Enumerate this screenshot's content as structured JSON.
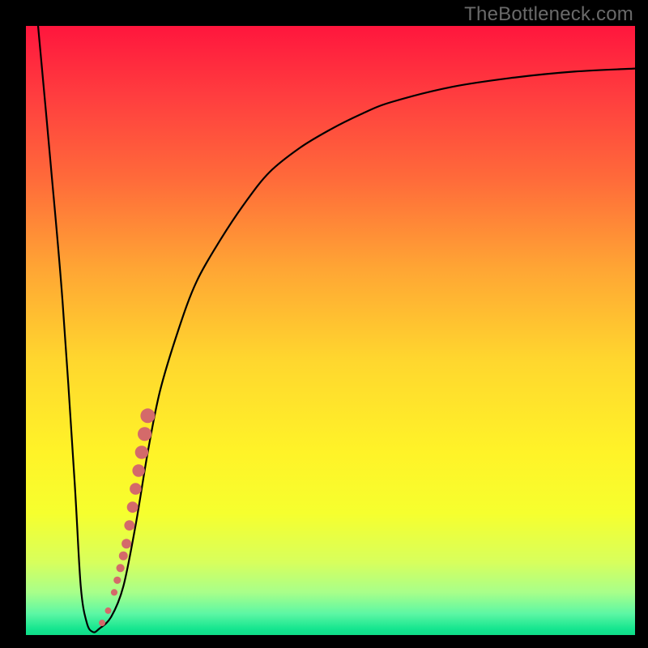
{
  "watermark": "TheBottleneck.com",
  "colors": {
    "background": "#000000",
    "watermark": "#6a6a6a",
    "curve": "#000000",
    "marker": "#d46a6a",
    "gradient_stops": [
      {
        "offset": 0.0,
        "color": "#ff163d"
      },
      {
        "offset": 0.12,
        "color": "#ff3f3f"
      },
      {
        "offset": 0.25,
        "color": "#ff6a3a"
      },
      {
        "offset": 0.4,
        "color": "#ffa634"
      },
      {
        "offset": 0.55,
        "color": "#ffd72e"
      },
      {
        "offset": 0.7,
        "color": "#fff328"
      },
      {
        "offset": 0.8,
        "color": "#f6ff2e"
      },
      {
        "offset": 0.88,
        "color": "#d8ff5c"
      },
      {
        "offset": 0.93,
        "color": "#a8ff8a"
      },
      {
        "offset": 0.965,
        "color": "#5cf7a4"
      },
      {
        "offset": 0.99,
        "color": "#15e58f"
      },
      {
        "offset": 1.0,
        "color": "#0fdc87"
      }
    ]
  },
  "chart_data": {
    "type": "line",
    "title": "",
    "xlabel": "",
    "ylabel": "",
    "xlim": [
      0,
      100
    ],
    "ylim": [
      0,
      100
    ],
    "grid": false,
    "note": "Axes unlabeled in source image; x interpreted as horizontal position 0–100 (left→right), y as bottleneck % 0–100 where 0 is the bottom green band and 100 is the top red edge. Values estimated from curve geometry.",
    "series": [
      {
        "name": "bottleneck-curve",
        "x": [
          2,
          4,
          6,
          8,
          9,
          10,
          11,
          12,
          14,
          16,
          18,
          20,
          22,
          25,
          28,
          32,
          36,
          40,
          45,
          50,
          55,
          60,
          70,
          80,
          90,
          100
        ],
        "y": [
          100,
          78,
          55,
          25,
          8,
          2,
          0.5,
          1,
          3,
          8,
          18,
          30,
          40,
          50,
          58,
          65,
          71,
          76,
          80,
          83,
          85.5,
          87.5,
          90,
          91.5,
          92.5,
          93
        ]
      }
    ],
    "markers": {
      "name": "highlighted-range",
      "note": "Salmon dotted segment along the rising branch of the curve.",
      "points": [
        {
          "x": 12.5,
          "y": 2
        },
        {
          "x": 13.5,
          "y": 4
        },
        {
          "x": 14.5,
          "y": 7
        },
        {
          "x": 15.0,
          "y": 9
        },
        {
          "x": 15.5,
          "y": 11
        },
        {
          "x": 16.0,
          "y": 13
        },
        {
          "x": 16.5,
          "y": 15
        },
        {
          "x": 17.0,
          "y": 18
        },
        {
          "x": 17.5,
          "y": 21
        },
        {
          "x": 18.0,
          "y": 24
        },
        {
          "x": 18.5,
          "y": 27
        },
        {
          "x": 19.0,
          "y": 30
        },
        {
          "x": 19.5,
          "y": 33
        },
        {
          "x": 20.0,
          "y": 36
        }
      ]
    }
  }
}
